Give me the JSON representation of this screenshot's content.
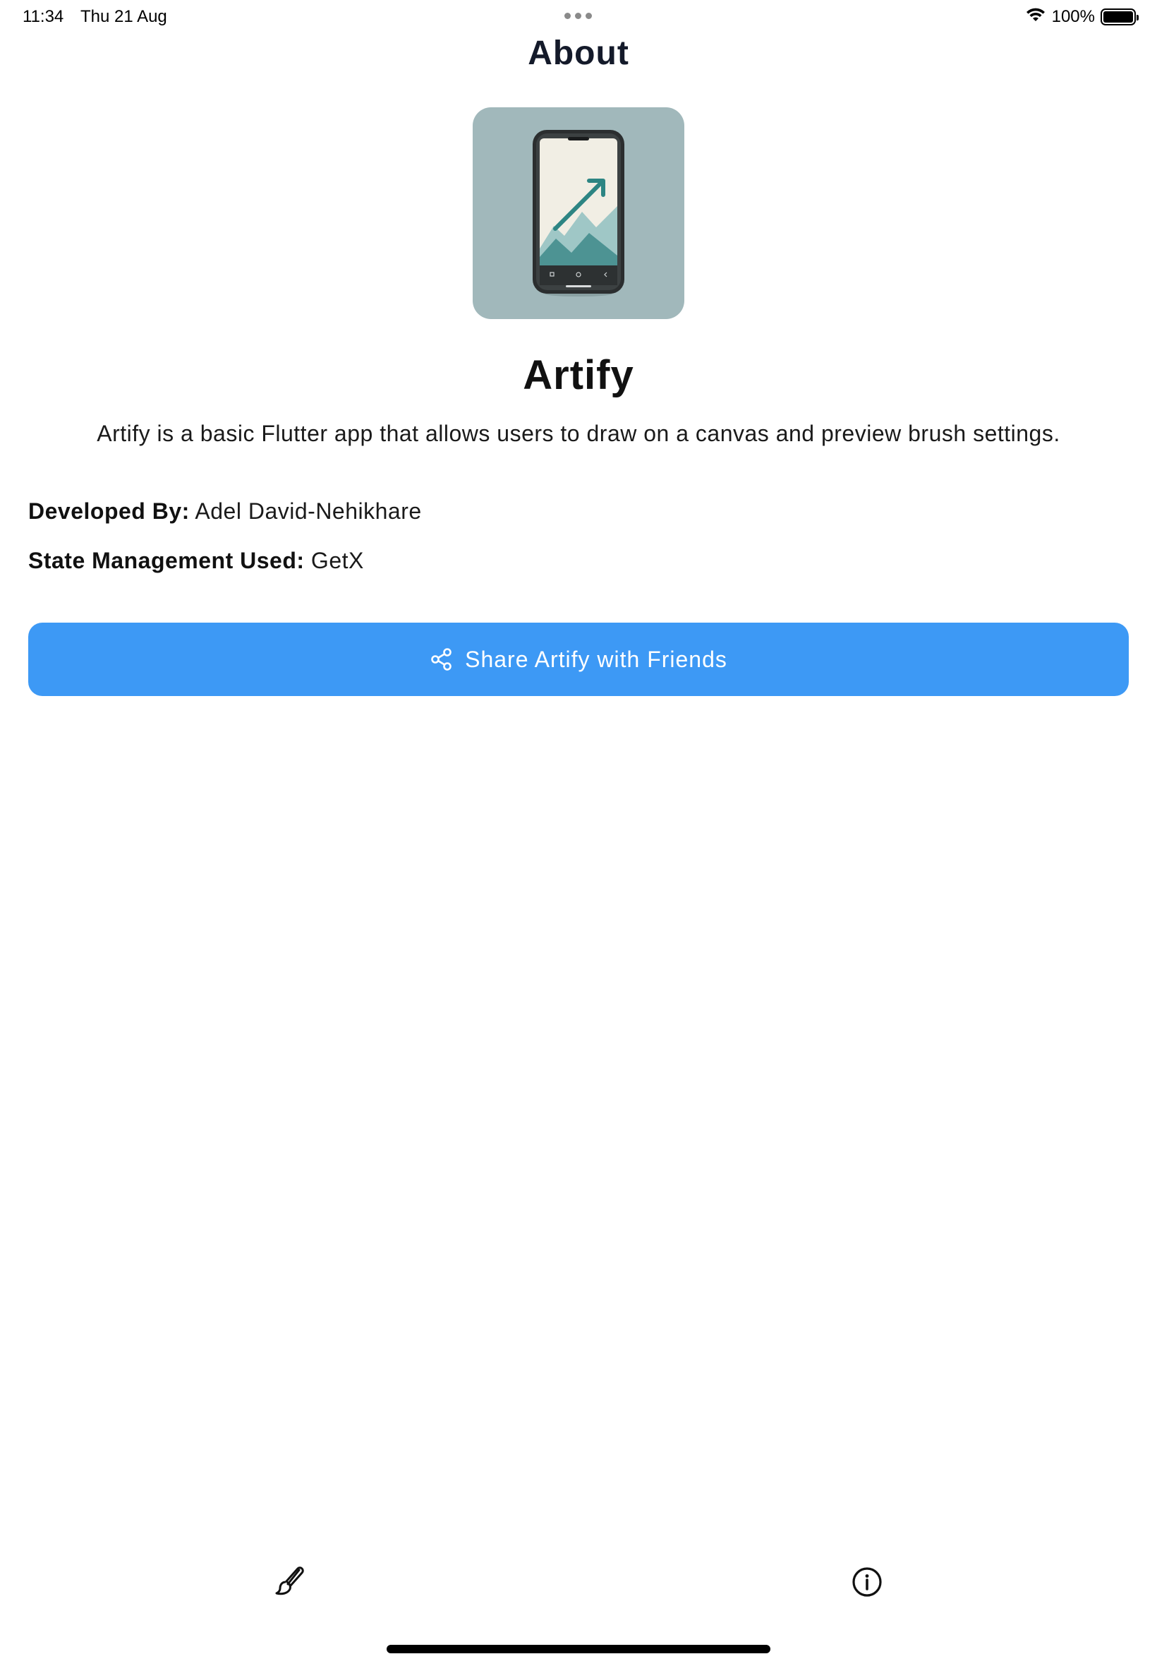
{
  "status_bar": {
    "time": "11:34",
    "date": "Thu 21 Aug",
    "battery": "100%",
    "icons": [
      "wifi-icon",
      "battery-icon"
    ]
  },
  "header": {
    "title": "About"
  },
  "app": {
    "icon": "app-logo-phone-chart",
    "name": "Artify",
    "description": "Artify is a basic Flutter app that allows users to draw on a canvas and preview brush settings."
  },
  "info": {
    "developed_by_label": "Developed By:",
    "developed_by_value": "Adel David-Nehikhare",
    "state_label": "State Management Used:",
    "state_value": "GetX"
  },
  "share_button": {
    "label": "Share Artify with Friends",
    "icon": "share-icon",
    "color": "#3d99f5"
  },
  "bottom_nav": {
    "items": [
      {
        "icon": "brush-icon"
      },
      {
        "icon": "info-icon"
      }
    ]
  }
}
